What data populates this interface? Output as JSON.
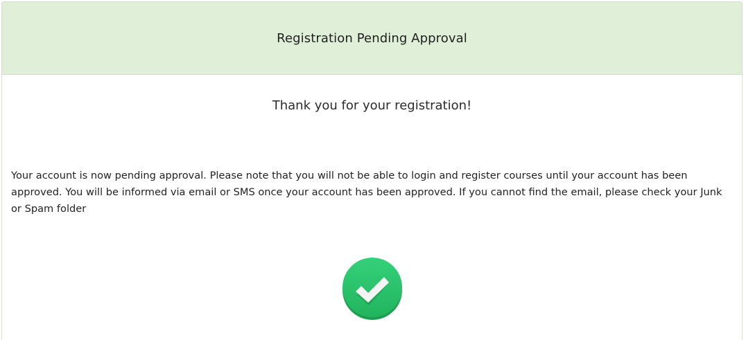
{
  "header": {
    "title": "Registration Pending Approval"
  },
  "body": {
    "thanks": "Thank you for your registration!",
    "message": "Your account is now pending approval. Please note that you will not be able to login and register courses until your account has been approved. You will be informed via email or SMS once your account has been approved. If you cannot find the email, please check your Junk or Spam folder",
    "status_icon": "check-circle-icon"
  },
  "colors": {
    "header_bg": "#e0efd8",
    "success_green": "#2ecc71",
    "success_green_dark": "#27ae60"
  }
}
